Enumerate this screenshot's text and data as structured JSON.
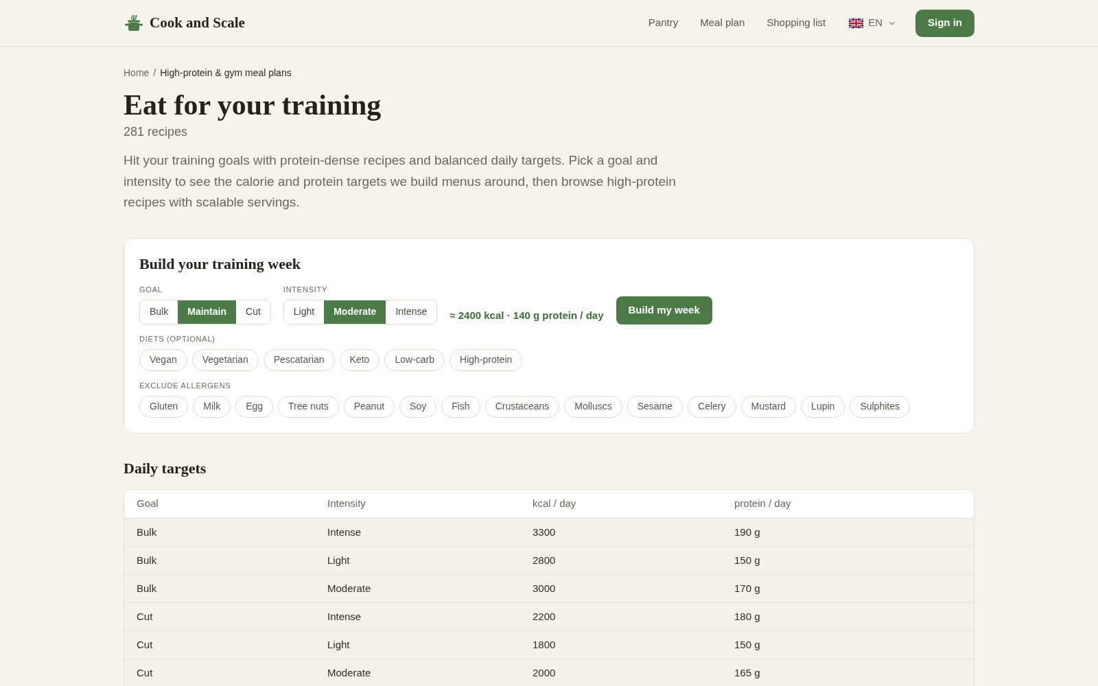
{
  "header": {
    "logo": "Cook and Scale",
    "nav": [
      {
        "label": "Pantry"
      },
      {
        "label": "Meal plan"
      },
      {
        "label": "Shopping list"
      }
    ],
    "language": "EN",
    "sign_in": "Sign in"
  },
  "breadcrumb": {
    "items": [
      {
        "label": "Home",
        "current": false
      },
      {
        "label": "High-protein & gym meal plans",
        "current": true
      }
    ],
    "separator": "/"
  },
  "page": {
    "title": "Eat for your training",
    "count": "281 recipes",
    "intro": "Hit your training goals with protein-dense recipes and balanced daily targets. Pick a goal and intensity to see the calorie and protein targets we build menus around, then browse high-protein recipes with scalable servings."
  },
  "planner": {
    "title": "Build your training week",
    "goal": {
      "label": "GOAL",
      "options": [
        {
          "label": "Bulk",
          "selected": false
        },
        {
          "label": "Maintain",
          "selected": true
        },
        {
          "label": "Cut",
          "selected": false
        }
      ]
    },
    "intensity": {
      "label": "INTENSITY",
      "options": [
        {
          "label": "Light",
          "selected": false
        },
        {
          "label": "Moderate",
          "selected": true
        },
        {
          "label": "Intense",
          "selected": false
        }
      ]
    },
    "summary": "≈ 2400 kcal · 140 g protein / day",
    "build_button": "Build my week",
    "diets": {
      "label": "DIETS (OPTIONAL)",
      "options": [
        {
          "label": "Vegan",
          "selected": false
        },
        {
          "label": "Vegetarian",
          "selected": false
        },
        {
          "label": "Pescatarian",
          "selected": false
        },
        {
          "label": "Keto",
          "selected": false
        },
        {
          "label": "Low-carb",
          "selected": false
        },
        {
          "label": "High-protein",
          "selected": false
        }
      ]
    },
    "allergens": {
      "label": "EXCLUDE ALLERGENS",
      "options": [
        {
          "label": "Gluten",
          "selected": false
        },
        {
          "label": "Milk",
          "selected": false
        },
        {
          "label": "Egg",
          "selected": false
        },
        {
          "label": "Tree nuts",
          "selected": false
        },
        {
          "label": "Peanut",
          "selected": false
        },
        {
          "label": "Soy",
          "selected": false
        },
        {
          "label": "Fish",
          "selected": false
        },
        {
          "label": "Crustaceans",
          "selected": false
        },
        {
          "label": "Molluscs",
          "selected": false
        },
        {
          "label": "Sesame",
          "selected": false
        },
        {
          "label": "Celery",
          "selected": false
        },
        {
          "label": "Mustard",
          "selected": false
        },
        {
          "label": "Lupin",
          "selected": false
        },
        {
          "label": "Sulphites",
          "selected": false
        }
      ]
    }
  },
  "daily_targets": {
    "title": "Daily targets",
    "columns": [
      "Goal",
      "Intensity",
      "kcal / day",
      "protein / day"
    ],
    "rows": [
      [
        "Bulk",
        "Intense",
        "3300",
        "190 g"
      ],
      [
        "Bulk",
        "Light",
        "2800",
        "150 g"
      ],
      [
        "Bulk",
        "Moderate",
        "3000",
        "170 g"
      ],
      [
        "Cut",
        "Intense",
        "2200",
        "180 g"
      ],
      [
        "Cut",
        "Light",
        "1800",
        "150 g"
      ],
      [
        "Cut",
        "Moderate",
        "2000",
        "165 g"
      ]
    ]
  }
}
